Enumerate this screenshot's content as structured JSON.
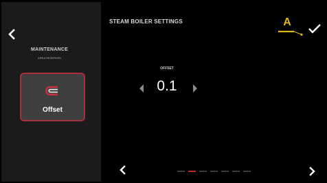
{
  "sidebar": {
    "title": "MAINTENANCE",
    "subtitle": "AREA RESERVED",
    "tile": {
      "label": "Offset",
      "icon": "offset-icon"
    }
  },
  "screen": {
    "title": "STEAM BOILER SETTINGS"
  },
  "annotation": {
    "letter": "A"
  },
  "parameter": {
    "label": "OFFSET",
    "value": "0.1"
  },
  "pagination": {
    "pages": 7,
    "active_page": 2
  },
  "colors": {
    "accent": "#c2262e",
    "annotation": "#e0b81c",
    "background": "#000000",
    "sidebar": "#1b1b1b",
    "tile": "#3e3e3e"
  }
}
